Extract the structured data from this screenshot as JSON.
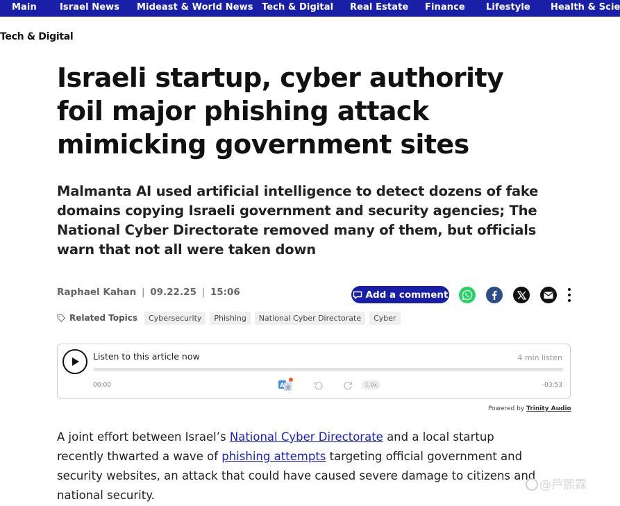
{
  "nav": {
    "items": [
      {
        "label": "Main"
      },
      {
        "label": "Israel News"
      },
      {
        "label": "Mideast & World News"
      },
      {
        "label": "Tech & Digital"
      },
      {
        "label": "Real Estate"
      },
      {
        "label": "Finance"
      },
      {
        "label": "Lifestyle"
      },
      {
        "label": "Health & Science"
      }
    ]
  },
  "section": {
    "label": "Tech & Digital"
  },
  "article": {
    "headline": "Israeli startup, cyber authority foil major phishing attack mimicking government sites",
    "subheadline": "Malmanta AI used artificial intelligence to detect dozens of fake domains copying Israeli government and security agencies; The National Cyber Directorate removed many of them, but officials warn that not all were taken down",
    "author": "Raphael Kahan",
    "date": "09.22.25",
    "time": "15:06",
    "body": {
      "p1_a": "A joint effort between Israel’s ",
      "p1_link1": "National Cyber Directorate",
      "p1_b": " and a local startup recently thwarted a wave of ",
      "p1_link2": "phishing attempts",
      "p1_c": " targeting official government and security websites, an attack that could have caused severe damage to citizens and national security."
    }
  },
  "actions": {
    "comment_label": "Add a comment",
    "share_icons": [
      "whatsapp-icon",
      "facebook-icon",
      "x-icon",
      "email-icon",
      "more-icon"
    ]
  },
  "topics": {
    "label": "Related Topics",
    "items": [
      "Cybersecurity",
      "Phishing",
      "National Cyber Directorate",
      "Cyber"
    ]
  },
  "player": {
    "title": "Listen to this article now",
    "duration": "4 min listen",
    "time_start": "00:00",
    "time_end": "-03:53",
    "speed": "1.0x",
    "progress": 0,
    "powered_prefix": "Powered by",
    "powered_brand": "Trinity Audio"
  },
  "watermark": {
    "text": "@芦熙霖"
  },
  "colors": {
    "nav_bg": "#1a1fa8",
    "accent": "#1a1fa8",
    "link": "#1a1fcc",
    "whatsapp": "#25d366",
    "facebook": "#2d4c8a"
  }
}
